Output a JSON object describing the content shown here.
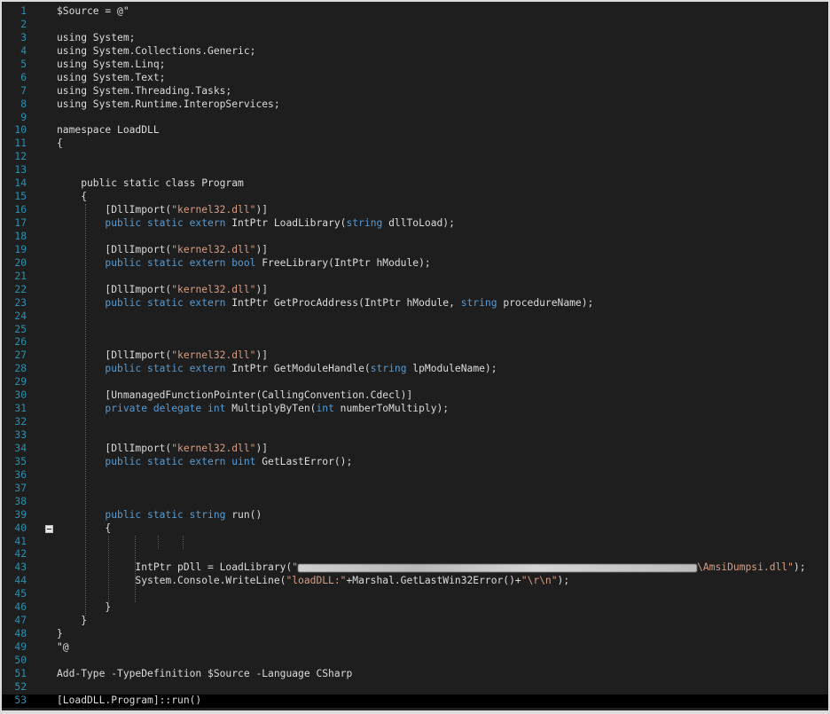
{
  "editor": {
    "lines": [
      {
        "n": "1",
        "tokens": [
          {
            "t": "$Source = @\"",
            "c": "plain"
          }
        ]
      },
      {
        "n": "2",
        "tokens": []
      },
      {
        "n": "3",
        "tokens": [
          {
            "t": "using System;",
            "c": "plain"
          }
        ]
      },
      {
        "n": "4",
        "tokens": [
          {
            "t": "using System.Collections.Generic;",
            "c": "plain"
          }
        ]
      },
      {
        "n": "5",
        "tokens": [
          {
            "t": "using System.Linq;",
            "c": "plain"
          }
        ]
      },
      {
        "n": "6",
        "tokens": [
          {
            "t": "using System.Text;",
            "c": "plain"
          }
        ]
      },
      {
        "n": "7",
        "tokens": [
          {
            "t": "using System.Threading.Tasks;",
            "c": "plain"
          }
        ]
      },
      {
        "n": "8",
        "tokens": [
          {
            "t": "using System.Runtime.InteropServices;",
            "c": "plain"
          }
        ]
      },
      {
        "n": "9",
        "tokens": []
      },
      {
        "n": "10",
        "tokens": [
          {
            "t": "namespace LoadDLL",
            "c": "plain"
          }
        ]
      },
      {
        "n": "11",
        "tokens": [
          {
            "t": "{",
            "c": "plain"
          }
        ]
      },
      {
        "n": "12",
        "tokens": []
      },
      {
        "n": "13",
        "tokens": []
      },
      {
        "n": "14",
        "tokens": [
          {
            "t": "    public static class Program",
            "c": "plain"
          }
        ]
      },
      {
        "n": "15",
        "tokens": [
          {
            "t": "    {",
            "c": "plain"
          }
        ]
      },
      {
        "n": "16",
        "tokens": [
          {
            "t": "        [DllImport(",
            "c": "plain"
          },
          {
            "t": "\"kernel32.dll\"",
            "c": "str"
          },
          {
            "t": ")]",
            "c": "plain"
          }
        ]
      },
      {
        "n": "17",
        "tokens": [
          {
            "t": "        public static extern ",
            "c": "kw"
          },
          {
            "t": "IntPtr LoadLibrary(",
            "c": "plain"
          },
          {
            "t": "string",
            "c": "kw"
          },
          {
            "t": " dllToLoad);",
            "c": "plain"
          }
        ]
      },
      {
        "n": "18",
        "tokens": []
      },
      {
        "n": "19",
        "tokens": [
          {
            "t": "        [DllImport(",
            "c": "plain"
          },
          {
            "t": "\"kernel32.dll\"",
            "c": "str"
          },
          {
            "t": ")]",
            "c": "plain"
          }
        ]
      },
      {
        "n": "20",
        "tokens": [
          {
            "t": "        public static extern bool ",
            "c": "kw"
          },
          {
            "t": "FreeLibrary(IntPtr hModule);",
            "c": "plain"
          }
        ]
      },
      {
        "n": "21",
        "tokens": []
      },
      {
        "n": "22",
        "tokens": [
          {
            "t": "        [DllImport(",
            "c": "plain"
          },
          {
            "t": "\"kernel32.dll\"",
            "c": "str"
          },
          {
            "t": ")]",
            "c": "plain"
          }
        ]
      },
      {
        "n": "23",
        "tokens": [
          {
            "t": "        public static extern ",
            "c": "kw"
          },
          {
            "t": "IntPtr GetProcAddress(IntPtr hModule, ",
            "c": "plain"
          },
          {
            "t": "string",
            "c": "kw"
          },
          {
            "t": " procedureName);",
            "c": "plain"
          }
        ]
      },
      {
        "n": "24",
        "tokens": []
      },
      {
        "n": "25",
        "tokens": []
      },
      {
        "n": "26",
        "tokens": []
      },
      {
        "n": "27",
        "tokens": [
          {
            "t": "        [DllImport(",
            "c": "plain"
          },
          {
            "t": "\"kernel32.dll\"",
            "c": "str"
          },
          {
            "t": ")]",
            "c": "plain"
          }
        ]
      },
      {
        "n": "28",
        "tokens": [
          {
            "t": "        public static extern ",
            "c": "kw"
          },
          {
            "t": "IntPtr GetModuleHandle(",
            "c": "plain"
          },
          {
            "t": "string",
            "c": "kw"
          },
          {
            "t": " lpModuleName);",
            "c": "plain"
          }
        ]
      },
      {
        "n": "29",
        "tokens": []
      },
      {
        "n": "30",
        "tokens": [
          {
            "t": "        [UnmanagedFunctionPointer(CallingConvention.Cdecl)]",
            "c": "plain"
          }
        ]
      },
      {
        "n": "31",
        "tokens": [
          {
            "t": "        private delegate int ",
            "c": "kw"
          },
          {
            "t": "MultiplyByTen(",
            "c": "plain"
          },
          {
            "t": "int",
            "c": "kw"
          },
          {
            "t": " numberToMultiply);",
            "c": "plain"
          }
        ]
      },
      {
        "n": "32",
        "tokens": []
      },
      {
        "n": "33",
        "tokens": []
      },
      {
        "n": "34",
        "tokens": [
          {
            "t": "        [DllImport(",
            "c": "plain"
          },
          {
            "t": "\"kernel32.dll\"",
            "c": "str"
          },
          {
            "t": ")]",
            "c": "plain"
          }
        ]
      },
      {
        "n": "35",
        "tokens": [
          {
            "t": "        public static extern uint ",
            "c": "kw"
          },
          {
            "t": "GetLastError();",
            "c": "plain"
          }
        ]
      },
      {
        "n": "36",
        "tokens": []
      },
      {
        "n": "37",
        "tokens": []
      },
      {
        "n": "38",
        "tokens": []
      },
      {
        "n": "39",
        "tokens": [
          {
            "t": "        public static string ",
            "c": "kw"
          },
          {
            "t": "run()",
            "c": "plain"
          }
        ]
      },
      {
        "n": "40",
        "tokens": [
          {
            "t": "        {",
            "c": "plain"
          }
        ]
      },
      {
        "n": "41",
        "tokens": []
      },
      {
        "n": "42",
        "tokens": []
      },
      {
        "n": "43",
        "tokens": [
          {
            "t": "             IntPtr pDll = LoadLibrary(",
            "c": "plain"
          },
          {
            "t": "\"",
            "c": "str"
          },
          {
            "t": "",
            "c": "redact"
          },
          {
            "t": "\\AmsiDumpsi.dll\"",
            "c": "str"
          },
          {
            "t": ");",
            "c": "plain"
          }
        ]
      },
      {
        "n": "44",
        "tokens": [
          {
            "t": "             System.Console.WriteLine(",
            "c": "plain"
          },
          {
            "t": "\"loadDLL:\"",
            "c": "str"
          },
          {
            "t": "+Marshal.GetLastWin32Error()+",
            "c": "plain"
          },
          {
            "t": "\"\\r\\n\"",
            "c": "str"
          },
          {
            "t": ");",
            "c": "plain"
          }
        ]
      },
      {
        "n": "45",
        "tokens": []
      },
      {
        "n": "46",
        "tokens": [
          {
            "t": "        }",
            "c": "plain"
          }
        ]
      },
      {
        "n": "47",
        "tokens": [
          {
            "t": "    }",
            "c": "plain"
          }
        ]
      },
      {
        "n": "48",
        "tokens": [
          {
            "t": "}",
            "c": "plain"
          }
        ]
      },
      {
        "n": "49",
        "tokens": [
          {
            "t": "\"@",
            "c": "plain"
          }
        ]
      },
      {
        "n": "50",
        "tokens": []
      },
      {
        "n": "51",
        "tokens": [
          {
            "t": "Add-Type -TypeDefinition $Source -Language CSharp",
            "c": "plain"
          }
        ]
      },
      {
        "n": "52",
        "tokens": []
      },
      {
        "n": "53",
        "tokens": [
          {
            "t": "[LoadDLL.Program]::run()",
            "c": "plain"
          }
        ]
      }
    ]
  }
}
